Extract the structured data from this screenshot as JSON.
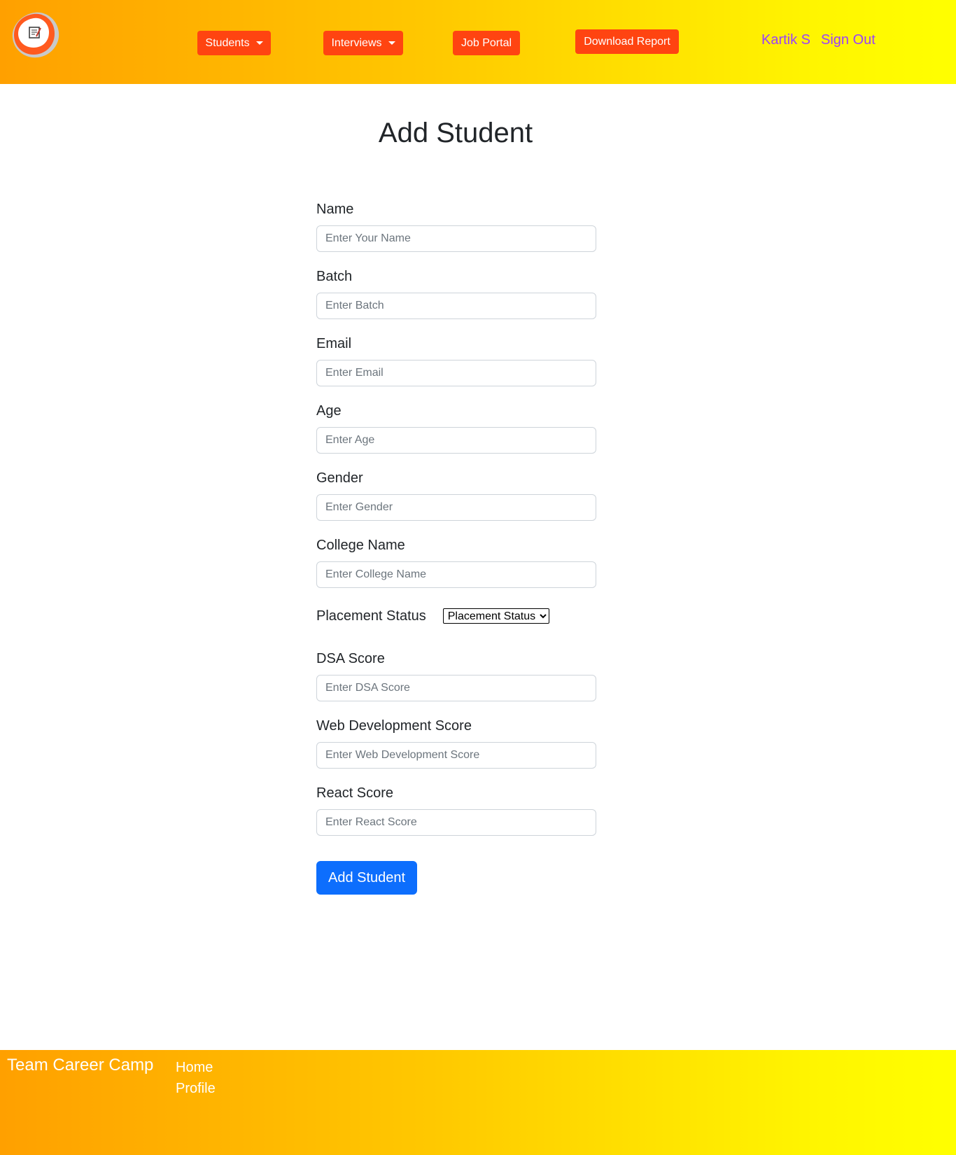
{
  "header": {
    "nav": {
      "students_label": "Students",
      "interviews_label": "Interviews",
      "job_portal_label": "Job Portal",
      "download_report_label": "Download Report"
    },
    "user": {
      "name": "Kartik S",
      "sign_out_label": "Sign Out"
    }
  },
  "page": {
    "title": "Add Student"
  },
  "form": {
    "name": {
      "label": "Name",
      "placeholder": "Enter Your Name"
    },
    "batch": {
      "label": "Batch",
      "placeholder": "Enter Batch"
    },
    "email": {
      "label": "Email",
      "placeholder": "Enter Email"
    },
    "age": {
      "label": "Age",
      "placeholder": "Enter Age"
    },
    "gender": {
      "label": "Gender",
      "placeholder": "Enter Gender"
    },
    "college": {
      "label": "College Name",
      "placeholder": "Enter College Name"
    },
    "placement_status": {
      "label": "Placement Status",
      "selected": "Placement Status"
    },
    "dsa": {
      "label": "DSA Score",
      "placeholder": "Enter DSA Score"
    },
    "webdev": {
      "label": "Web Development Score",
      "placeholder": "Enter Web Development Score"
    },
    "react": {
      "label": "React Score",
      "placeholder": "Enter React Score"
    },
    "submit_label": "Add Student"
  },
  "footer": {
    "brand": "Team Career Camp",
    "links": {
      "home": "Home",
      "profile": "Profile"
    }
  },
  "colors": {
    "nav_button": "#ff4411",
    "user_link": "#9b40ff",
    "submit_button": "#0d6efd",
    "gradient_start": "#ffa000",
    "gradient_end": "#ffff00"
  }
}
